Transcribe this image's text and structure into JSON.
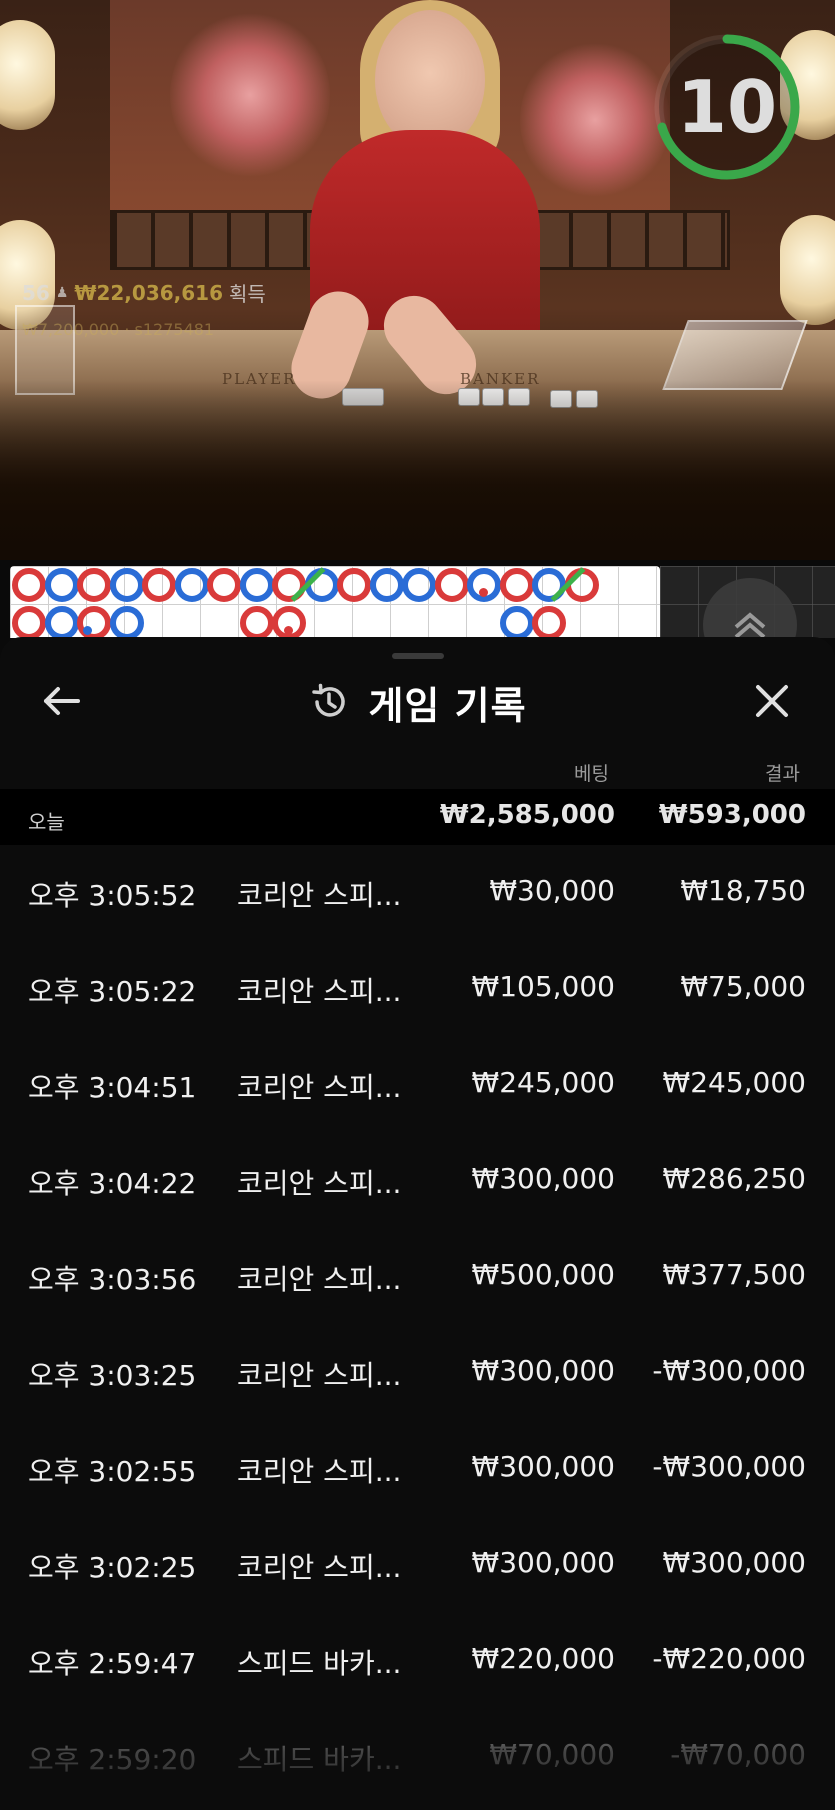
{
  "stream": {
    "players_count": "56",
    "winnings": "₩22,036,616",
    "winnings_label": "획득",
    "limits": "₩7,200,000 · s1275481",
    "table_left_label": "PLAYER",
    "table_right_label": "BANKER",
    "countdown": "10"
  },
  "roadmap": {
    "top_row": [
      "B",
      "P",
      "B",
      "P",
      "B",
      "P",
      "B",
      "P",
      "B",
      "P",
      "B",
      "P",
      "P",
      "B",
      "P",
      "B",
      "P",
      "B"
    ],
    "bottom_row": [
      "B",
      "P",
      "B",
      "P",
      "",
      "",
      "",
      "B",
      "B",
      "",
      "",
      "",
      "",
      "",
      "",
      "P",
      "B",
      ""
    ]
  },
  "sheet": {
    "title": "게임 기록",
    "columns": {
      "bet": "베팅",
      "result": "결과"
    },
    "today": {
      "label": "오늘",
      "bet": "₩2,585,000",
      "result": "₩593,000"
    },
    "rows": [
      {
        "time": "오후 3:05:52",
        "game": "코리안 스피...",
        "bet": "₩30,000",
        "result": "₩18,750"
      },
      {
        "time": "오후 3:05:22",
        "game": "코리안 스피...",
        "bet": "₩105,000",
        "result": "₩75,000"
      },
      {
        "time": "오후 3:04:51",
        "game": "코리안 스피...",
        "bet": "₩245,000",
        "result": "₩245,000"
      },
      {
        "time": "오후 3:04:22",
        "game": "코리안 스피...",
        "bet": "₩300,000",
        "result": "₩286,250"
      },
      {
        "time": "오후 3:03:56",
        "game": "코리안 스피...",
        "bet": "₩500,000",
        "result": "₩377,500"
      },
      {
        "time": "오후 3:03:25",
        "game": "코리안 스피...",
        "bet": "₩300,000",
        "result": "-₩300,000"
      },
      {
        "time": "오후 3:02:55",
        "game": "코리안 스피...",
        "bet": "₩300,000",
        "result": "-₩300,000"
      },
      {
        "time": "오후 3:02:25",
        "game": "코리안 스피...",
        "bet": "₩300,000",
        "result": "₩300,000"
      },
      {
        "time": "오후 2:59:47",
        "game": "스피드 바카...",
        "bet": "₩220,000",
        "result": "-₩220,000"
      },
      {
        "time": "오후 2:59:20",
        "game": "스피드 바카...",
        "bet": "₩70,000",
        "result": "-₩70,000"
      }
    ]
  },
  "colors": {
    "banker": "#d93a3a",
    "player": "#2a6cd6",
    "tie": "#3db24a",
    "timer": "#3aa84a"
  }
}
